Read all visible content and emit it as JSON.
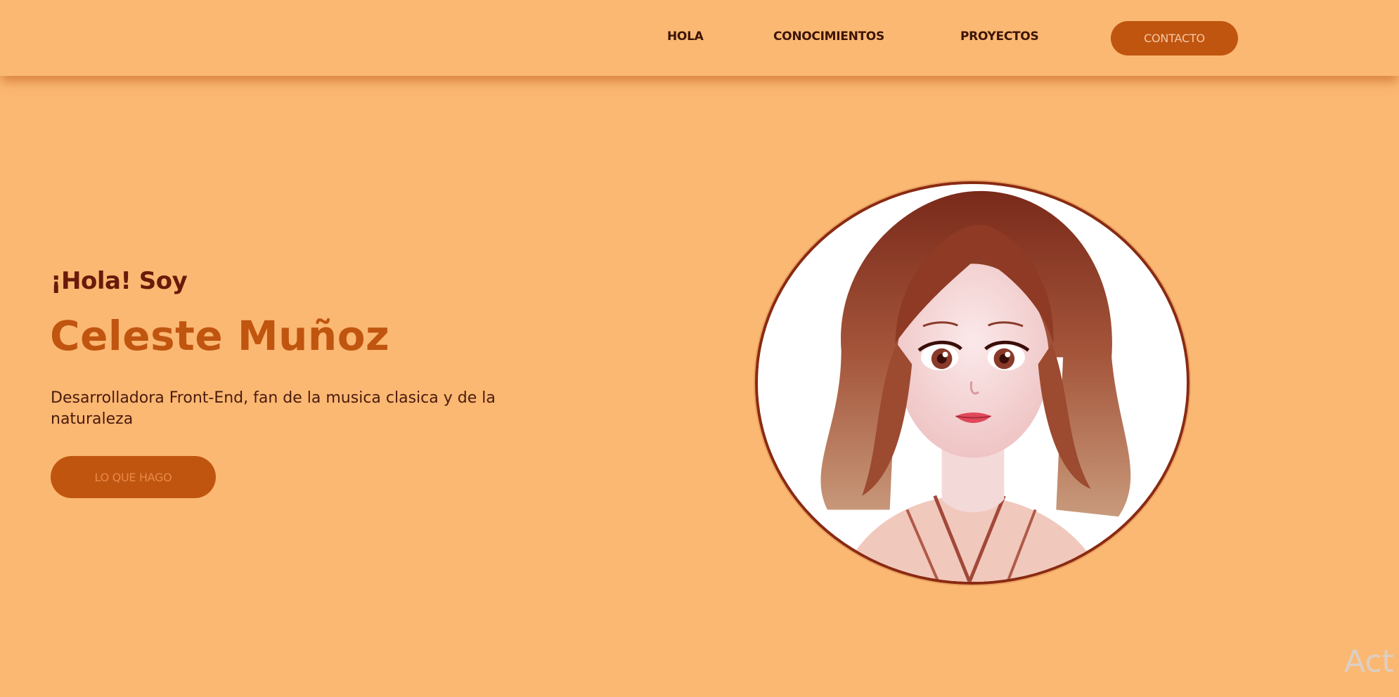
{
  "nav": {
    "items": [
      "HOLA",
      "CONOCIMIENTOS",
      "PROYECTOS"
    ],
    "contact_label": "CONTACTO"
  },
  "hero": {
    "greeting": "¡Hola! Soy",
    "name": "Celeste Muñoz",
    "description": "Desarrolladora Front-End, fan de la musica clasica y de la naturaleza",
    "cta_label": "LO QUE HAGO"
  },
  "watermark": "Act",
  "colors": {
    "background": "#fbb872",
    "accent": "#c05510",
    "dark_text": "#6a1a0a",
    "portrait_border": "#8a2a12"
  },
  "icons": {
    "portrait": "anime-girl-portrait"
  }
}
